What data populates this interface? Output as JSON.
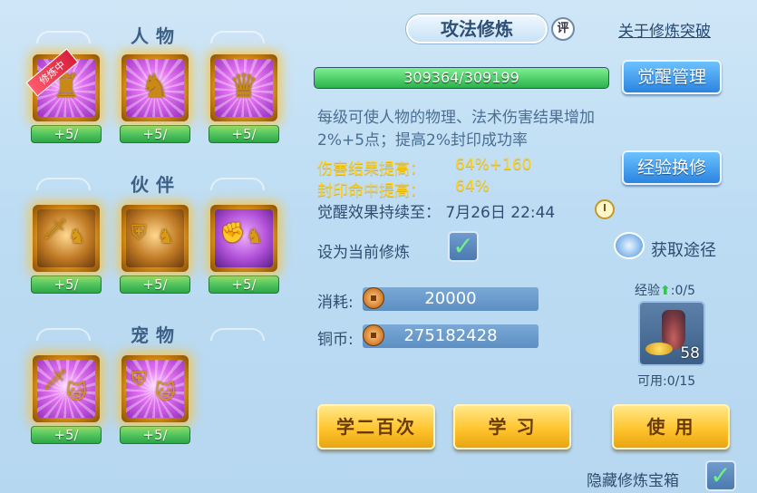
{
  "sections": {
    "character": "人物",
    "partner": "伙伴",
    "pet": "宠物"
  },
  "slots": {
    "character": [
      {
        "level": "+5/",
        "training_tag": "修炼中",
        "icon": "golden-warrior-icon"
      },
      {
        "level": "+5/",
        "icon": "warrior-shield-icon"
      },
      {
        "level": "+5/",
        "icon": "warrior-stance-icon"
      }
    ],
    "partner": [
      {
        "level": "+5/",
        "icon": "partner-sword-icon"
      },
      {
        "level": "+5/",
        "icon": "partner-shield-icon"
      },
      {
        "level": "+5/",
        "icon": "partner-fist-icon"
      }
    ],
    "pet": [
      {
        "level": "+5/",
        "icon": "pet-sword-icon"
      },
      {
        "level": "+5/",
        "icon": "pet-shield-icon"
      }
    ]
  },
  "header": {
    "title": "攻法修炼",
    "comment_badge": "评",
    "about_link": "关于修炼突破"
  },
  "progress": {
    "text": "309364/309199",
    "fraction": 1.0
  },
  "buttons": {
    "awaken_manage": "觉醒管理",
    "exp_exchange": "经验换修",
    "get_source": "获取途径",
    "learn_200": "学二百次",
    "learn": "学 习",
    "use": "使 用"
  },
  "description": "每级可使人物的物理、法术伤害结果增加2%+5点；提高2%封印成功率",
  "stats": {
    "damage_label": "伤害结果提高：",
    "damage_value": "64%+160",
    "seal_label": "封印命中提高：",
    "seal_value": "64%"
  },
  "awaken_expire": "觉醒效果持续至： 7月26日 22:44",
  "set_current_label": "设为当前修炼",
  "costs": {
    "consume_label": "消耗:",
    "consume_value": "20000",
    "copper_label": "铜币:",
    "copper_value": "275182428"
  },
  "item": {
    "exp_label": "经验",
    "exp_value": ":0/5",
    "count": "58",
    "available": "可用:0/15"
  },
  "hide_treasure_label": "隐藏修炼宝箱",
  "colors": {
    "stat_yellow": "#ffd01a",
    "progress_green": "#2bb24c",
    "button_blue": "#2b84e0",
    "button_gold": "#ffc52e"
  }
}
